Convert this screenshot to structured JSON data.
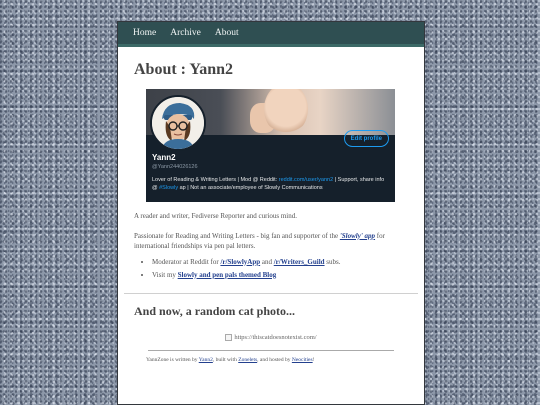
{
  "nav": {
    "items": [
      "Home",
      "Archive",
      "About"
    ]
  },
  "page": {
    "title": "About : Yann2"
  },
  "profile": {
    "name": "Yann2",
    "handle": "@Yann244026126",
    "edit_label": "Edit profile",
    "bio_1": "Lover of Reading & Writing Letters | Mod @ Reddit: ",
    "bio_link_1": "reddit.com/user/yann2",
    "bio_2": " | Support, share info @ ",
    "bio_link_2": "#Slowly",
    "bio_3": " ap | Not an associate/employee of Slowly Communications"
  },
  "intro": "A reader and writer, Fediverse Reporter and curious mind.",
  "passion": {
    "before": "Passionate for Reading and Writing Letters - big fan and supporter of the ",
    "link": "'Slowly' app",
    "after": " for international friendships via pen pal letters."
  },
  "list": {
    "item1_before": "Moderator at Reddit for ",
    "item1_link1": "/r/SlowlyApp",
    "item1_mid": " and ",
    "item1_link2": "/r/Writers_Guild",
    "item1_after": " subs.",
    "item2_before": "Visit my ",
    "item2_link": "Slowly and pen pals themed Blog"
  },
  "cat": {
    "heading": "And now, a random cat photo...",
    "alt": "https://thiscatdoesnotexist.com/"
  },
  "footer": {
    "t1": "YannZone is written by ",
    "l1": "Yann2",
    "t2": ", built with ",
    "l2": "Zonelets",
    "t3": ", and hosted by ",
    "l3": "Neocities",
    "t4": "!"
  }
}
